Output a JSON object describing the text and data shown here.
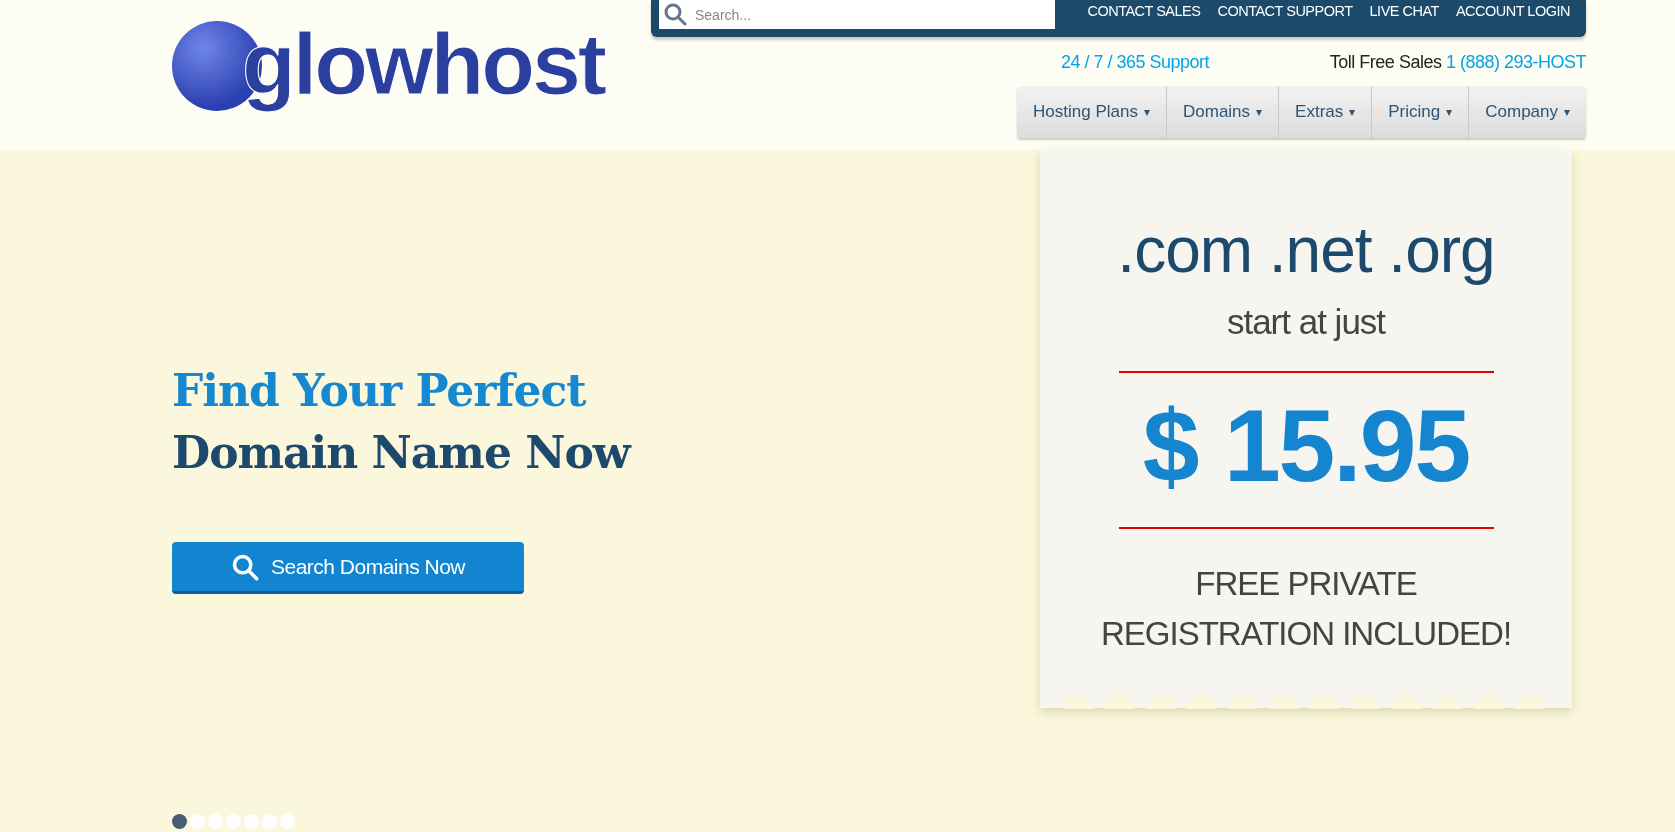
{
  "logo": {
    "text": "glowhost"
  },
  "search": {
    "placeholder": "Search..."
  },
  "top_links": [
    "CONTACT SALES",
    "CONTACT SUPPORT",
    "LIVE CHAT",
    "ACCOUNT LOGIN"
  ],
  "support": "24 / 7 / 365 Support",
  "sales": {
    "label": "Toll Free Sales",
    "phone": "1 (888) 293-HOST"
  },
  "nav": [
    "Hosting Plans",
    "Domains",
    "Extras",
    "Pricing",
    "Company"
  ],
  "nav_caret": "▾",
  "hero": {
    "line_1": "Find Your Perfect",
    "line_2": "Domain Name Now",
    "button": "Search Domains Now"
  },
  "ticket": {
    "tlds": ".com .net .org",
    "intro": "start at just",
    "price": "$ 15.95",
    "note_1": "FREE PRIVATE",
    "note_2": "REGISTRATION INCLUDED!"
  },
  "slides": [
    {
      "selected": true
    },
    {
      "selected": false
    },
    {
      "selected": false
    },
    {
      "selected": false
    },
    {
      "selected": false
    },
    {
      "selected": false
    },
    {
      "selected": false
    }
  ]
}
